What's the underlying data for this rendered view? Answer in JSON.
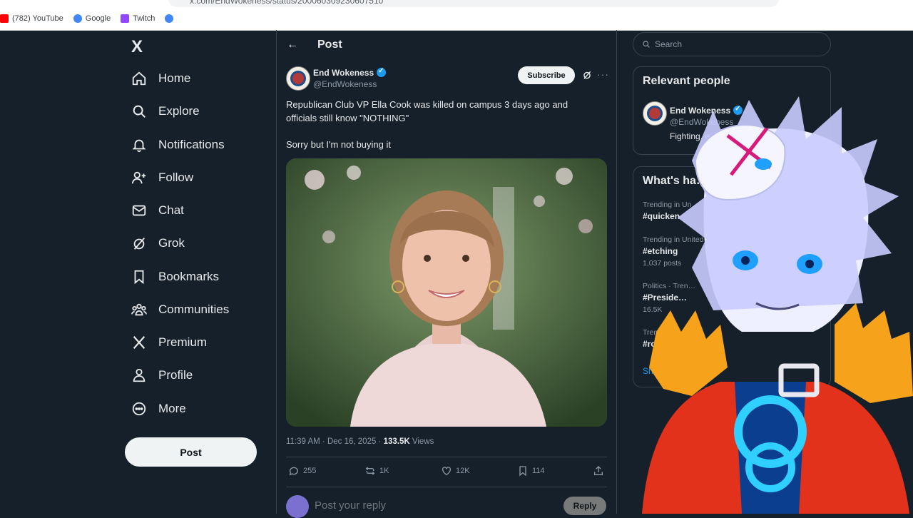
{
  "browser": {
    "url": "x.com/EndWokeness/status/200060309230607510",
    "bookmarks": [
      {
        "label": "(782) YouTube",
        "color": "#ff0000"
      },
      {
        "label": "Google",
        "color": "#4285f4"
      },
      {
        "label": "Twitch",
        "color": "#9146ff"
      },
      {
        "label": "",
        "color": "#4285f4"
      }
    ]
  },
  "nav": {
    "logo": "X",
    "items": [
      {
        "label": "Home",
        "icon": "home-icon"
      },
      {
        "label": "Explore",
        "icon": "search-icon"
      },
      {
        "label": "Notifications",
        "icon": "bell-icon"
      },
      {
        "label": "Follow",
        "icon": "person-plus-icon"
      },
      {
        "label": "Chat",
        "icon": "envelope-icon"
      },
      {
        "label": "Grok",
        "icon": "grok-icon"
      },
      {
        "label": "Bookmarks",
        "icon": "bookmark-icon"
      },
      {
        "label": "Communities",
        "icon": "communities-icon"
      },
      {
        "label": "Premium",
        "icon": "x-logo-icon"
      },
      {
        "label": "Profile",
        "icon": "person-icon"
      },
      {
        "label": "More",
        "icon": "more-circle-icon"
      }
    ],
    "post_label": "Post"
  },
  "header": {
    "title": "Post"
  },
  "post": {
    "author_name": "End Wokeness",
    "author_handle": "@EndWokeness",
    "subscribe_label": "Subscribe",
    "text_line1": "Republican Club VP Ella Cook was killed on campus 3 days ago and officials still know \"NOTHING\"",
    "text_line2": "Sorry but I'm not buying it",
    "time": "11:39 AM · Dec 16, 2025 · ",
    "views_count": "133.5K",
    "views_label": " Views",
    "stats": {
      "replies": "255",
      "reposts": "1K",
      "likes": "12K",
      "bookmarks": "114"
    }
  },
  "reply": {
    "placeholder": "Post your reply",
    "button": "Reply"
  },
  "sidebar": {
    "search_placeholder": "Search",
    "relevant_title": "Relevant people",
    "relevant_person": {
      "name": "End Wokeness",
      "handle": "@EndWokeness",
      "bio": "Fighting, e… wokene…"
    },
    "trending_title": "What's ha…",
    "trends": [
      {
        "context": "Trending in Un…",
        "tag": "#quicken",
        "count": ""
      },
      {
        "context": "Trending in United",
        "tag": "#etching",
        "count": "1,037 posts"
      },
      {
        "context": "Politics · Tren…",
        "tag": "#Preside…",
        "count": "16.5K"
      },
      {
        "context": "Trendi…",
        "tag": "#rots…",
        "count": ""
      }
    ],
    "show_more": "Show…"
  },
  "colors": {
    "background": "#15202b",
    "accent": "#1d9bf0",
    "border": "#38444d"
  }
}
